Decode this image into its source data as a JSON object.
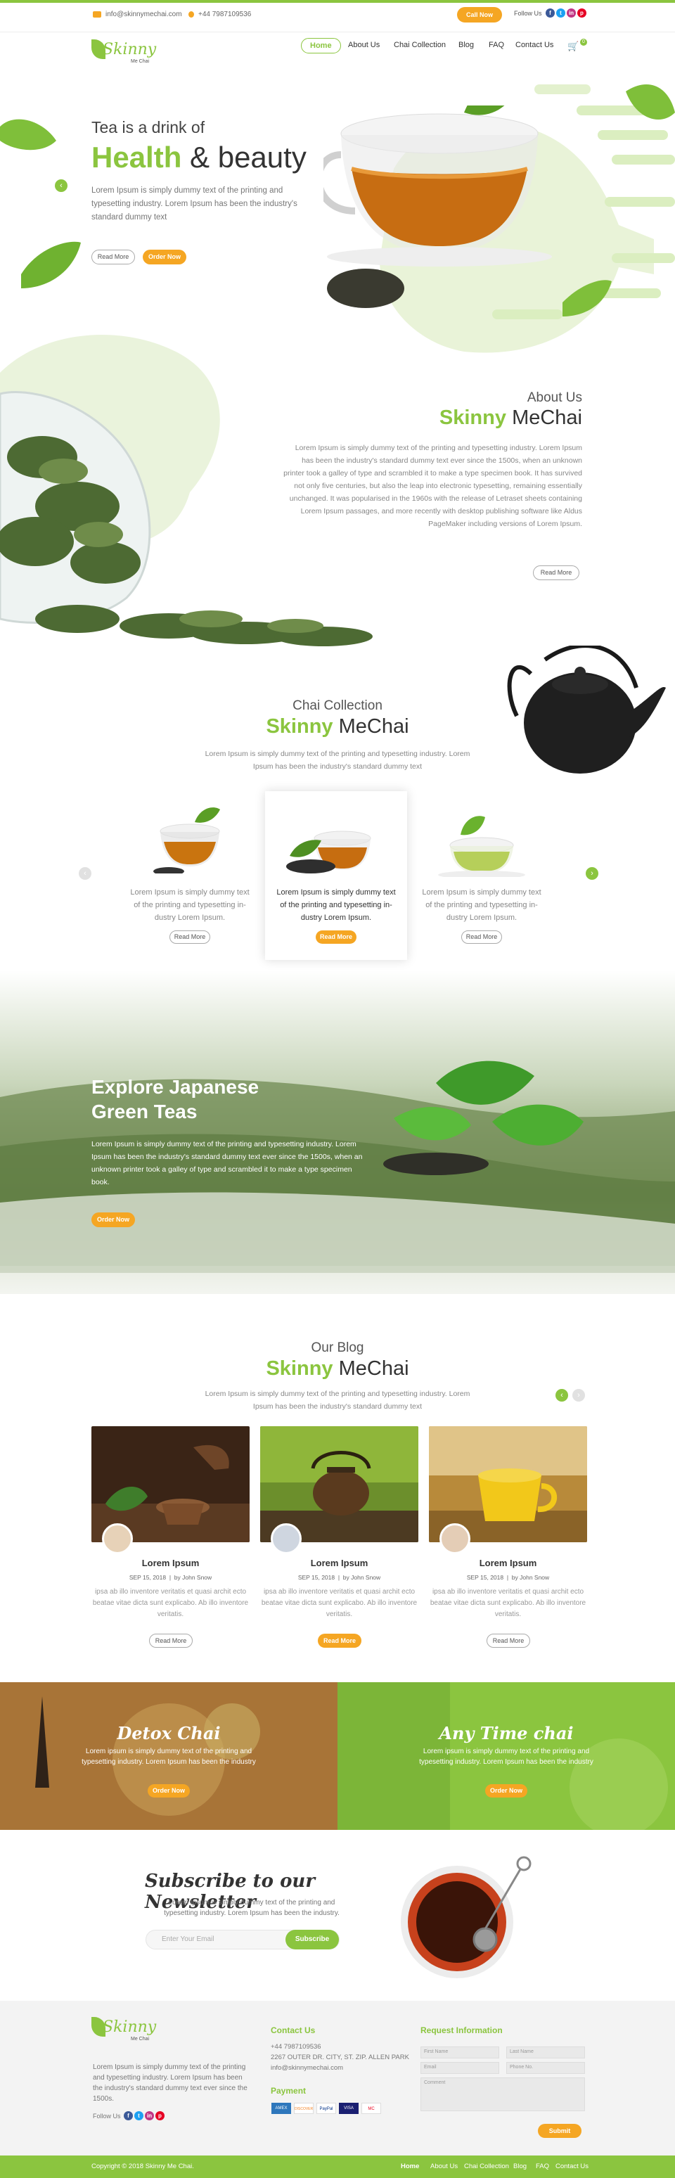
{
  "topbar": {
    "email": "info@skinnymechai.com",
    "phone": "+44 7987109536",
    "call_now": "Call Now",
    "follow_us": "Follow Us",
    "socials": [
      "f",
      "t",
      "in",
      "p"
    ]
  },
  "brand": {
    "name": "Skinny",
    "tagline": "Me Chai"
  },
  "nav": {
    "items": [
      "Home",
      "About Us",
      "Chai Collection",
      "Blog",
      "FAQ",
      "Contact Us"
    ],
    "active": "Home",
    "cart_count": "0"
  },
  "hero": {
    "kicker": "Tea is a drink of",
    "title_green": "Health",
    "title_rest": "& beauty",
    "text": "Lorem Ipsum is simply dummy text of the printing and typesetting industry. Lorem Ipsum has been the industry's standard dummy text",
    "read_more": "Read More",
    "order_now": "Order Now"
  },
  "about": {
    "kicker": "About Us",
    "title_green": "Skinny",
    "title_rest": "MeChai",
    "text": "Lorem Ipsum is simply dummy text of the printing and typesetting industry. Lorem Ipsum has been the industry's standard dummy text ever since the 1500s, when an unknown printer took a galley of type and scrambled it to make a type specimen book. It has survived not only five centuries, but also the leap into electronic typesetting, remaining essentially unchanged. It was popularised in the 1960s with the release of Letraset sheets containing Lorem Ipsum passages, and more recently with desktop publishing software like Aldus PageMaker including versions of Lorem Ipsum.",
    "read_more": "Read More"
  },
  "collection": {
    "kicker": "Chai Collection",
    "title_green": "Skinny",
    "title_rest": "MeChai",
    "text": "Lorem Ipsum is simply dummy text of the printing and typesetting industry. Lorem Ipsum has been the industry's standard dummy text",
    "cards": [
      {
        "text": "Lorem Ipsum is simply dummy text of the printing and typesetting in-dustry Lorem Ipsum.",
        "button": "Read More"
      },
      {
        "text": "Lorem Ipsum is simply dummy text of the printing and typesetting in-dustry Lorem Ipsum.",
        "button": "Read More"
      },
      {
        "text": "Lorem Ipsum is simply dummy text of the printing and typesetting in-dustry Lorem Ipsum.",
        "button": "Read More"
      }
    ]
  },
  "explore": {
    "title_line1": "Explore Japanese",
    "title_line2": "Green Teas",
    "text": "Lorem Ipsum is simply dummy text of the printing and typesetting industry. Lorem Ipsum has been the industry's standard dummy text ever since the 1500s, when an unknown printer took a galley of type and scrambled it to make a type specimen book.",
    "button": "Order Now"
  },
  "blog": {
    "kicker": "Our Blog",
    "title_green": "Skinny",
    "title_rest": "MeChai",
    "text": "Lorem Ipsum is simply dummy text of the printing and typesetting industry. Lorem Ipsum has been the industry's standard dummy text",
    "posts": [
      {
        "title": "Lorem Ipsum",
        "date": "SEP 15, 2018",
        "author": "by John Snow",
        "text": "ipsa ab illo inventore veritatis et quasi archit ecto beatae vitae dicta sunt explicabo. Ab illo inventore veritatis.",
        "button": "Read More"
      },
      {
        "title": "Lorem Ipsum",
        "date": "SEP 15, 2018",
        "author": "by John Snow",
        "text": "ipsa ab illo inventore veritatis et quasi archit ecto beatae vitae dicta sunt explicabo. Ab illo inventore veritatis.",
        "button": "Read More"
      },
      {
        "title": "Lorem Ipsum",
        "date": "SEP 15, 2018",
        "author": "by John Snow",
        "text": "ipsa ab illo inventore veritatis et quasi archit ecto beatae vitae dicta sunt explicabo. Ab illo inventore veritatis.",
        "button": "Read More"
      }
    ]
  },
  "promos": [
    {
      "title": "Detox Chai",
      "text": "Lorem ipsum is simply dummy text of the printing and typesetting industry. Lorem Ipsum has been the industry",
      "button": "Order Now"
    },
    {
      "title": "Any Time chai",
      "text": "Lorem ipsum is simply dummy text of the printing and typesetting industry. Lorem Ipsum has been the industry",
      "button": "Order Now"
    }
  ],
  "newsletter": {
    "title": "Subscribe to our Newsletter",
    "text": "Lorem Ipsum is simply dummy text of the printing and typesetting industry. Lorem Ipsum has been the industry.",
    "placeholder": "Enter Your Email",
    "button": "Subscribe"
  },
  "footer": {
    "about": "Lorem Ipsum is simply dummy text of the printing and typesetting industry. Lorem Ipsum has been the industry's standard dummy text ever since the 1500s.",
    "follow_us": "Follow Us",
    "contact_title": "Contact Us",
    "phone": "+44 7987109536",
    "address": "2267 OUTER DR. CITY, ST. ZIP. ALLEN PARK",
    "email": "info@skinnymechai.com",
    "payment_title": "Payment",
    "payments": [
      "AMEX",
      "DISCOVER",
      "PayPal",
      "VISA",
      "MC"
    ],
    "request_title": "Request Information",
    "fields": {
      "first": "First Name",
      "last": "Last Name",
      "email": "Email",
      "phone": "Phone No.",
      "comment": "Comment"
    },
    "submit": "Submit",
    "copyright": "Copyright © 2018 Skinny Me Chai.",
    "menu": [
      "Home",
      "About Us",
      "Chai Collection",
      "Blog",
      "FAQ",
      "Contact Us"
    ]
  },
  "colors": {
    "green": "#8bc53f",
    "orange": "#f5a623",
    "dark": "#333333"
  }
}
